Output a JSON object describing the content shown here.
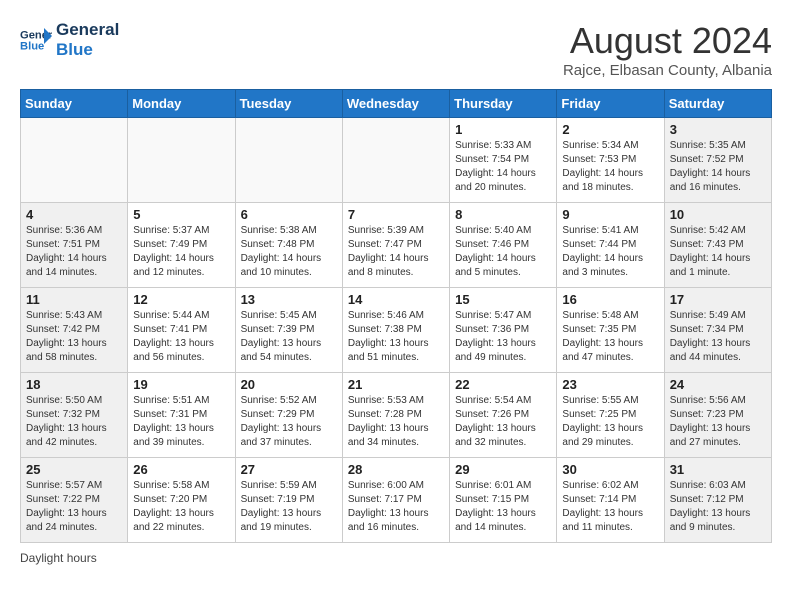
{
  "header": {
    "logo_line1": "General",
    "logo_line2": "Blue",
    "month_title": "August 2024",
    "subtitle": "Rajce, Elbasan County, Albania"
  },
  "calendar": {
    "days_of_week": [
      "Sunday",
      "Monday",
      "Tuesday",
      "Wednesday",
      "Thursday",
      "Friday",
      "Saturday"
    ],
    "weeks": [
      [
        {
          "day": "",
          "info": "",
          "empty": true
        },
        {
          "day": "",
          "info": "",
          "empty": true
        },
        {
          "day": "",
          "info": "",
          "empty": true
        },
        {
          "day": "",
          "info": "",
          "empty": true
        },
        {
          "day": "1",
          "info": "Sunrise: 5:33 AM\nSunset: 7:54 PM\nDaylight: 14 hours\nand 20 minutes.",
          "empty": false
        },
        {
          "day": "2",
          "info": "Sunrise: 5:34 AM\nSunset: 7:53 PM\nDaylight: 14 hours\nand 18 minutes.",
          "empty": false
        },
        {
          "day": "3",
          "info": "Sunrise: 5:35 AM\nSunset: 7:52 PM\nDaylight: 14 hours\nand 16 minutes.",
          "empty": false
        }
      ],
      [
        {
          "day": "4",
          "info": "Sunrise: 5:36 AM\nSunset: 7:51 PM\nDaylight: 14 hours\nand 14 minutes.",
          "empty": false
        },
        {
          "day": "5",
          "info": "Sunrise: 5:37 AM\nSunset: 7:49 PM\nDaylight: 14 hours\nand 12 minutes.",
          "empty": false
        },
        {
          "day": "6",
          "info": "Sunrise: 5:38 AM\nSunset: 7:48 PM\nDaylight: 14 hours\nand 10 minutes.",
          "empty": false
        },
        {
          "day": "7",
          "info": "Sunrise: 5:39 AM\nSunset: 7:47 PM\nDaylight: 14 hours\nand 8 minutes.",
          "empty": false
        },
        {
          "day": "8",
          "info": "Sunrise: 5:40 AM\nSunset: 7:46 PM\nDaylight: 14 hours\nand 5 minutes.",
          "empty": false
        },
        {
          "day": "9",
          "info": "Sunrise: 5:41 AM\nSunset: 7:44 PM\nDaylight: 14 hours\nand 3 minutes.",
          "empty": false
        },
        {
          "day": "10",
          "info": "Sunrise: 5:42 AM\nSunset: 7:43 PM\nDaylight: 14 hours\nand 1 minute.",
          "empty": false
        }
      ],
      [
        {
          "day": "11",
          "info": "Sunrise: 5:43 AM\nSunset: 7:42 PM\nDaylight: 13 hours\nand 58 minutes.",
          "empty": false
        },
        {
          "day": "12",
          "info": "Sunrise: 5:44 AM\nSunset: 7:41 PM\nDaylight: 13 hours\nand 56 minutes.",
          "empty": false
        },
        {
          "day": "13",
          "info": "Sunrise: 5:45 AM\nSunset: 7:39 PM\nDaylight: 13 hours\nand 54 minutes.",
          "empty": false
        },
        {
          "day": "14",
          "info": "Sunrise: 5:46 AM\nSunset: 7:38 PM\nDaylight: 13 hours\nand 51 minutes.",
          "empty": false
        },
        {
          "day": "15",
          "info": "Sunrise: 5:47 AM\nSunset: 7:36 PM\nDaylight: 13 hours\nand 49 minutes.",
          "empty": false
        },
        {
          "day": "16",
          "info": "Sunrise: 5:48 AM\nSunset: 7:35 PM\nDaylight: 13 hours\nand 47 minutes.",
          "empty": false
        },
        {
          "day": "17",
          "info": "Sunrise: 5:49 AM\nSunset: 7:34 PM\nDaylight: 13 hours\nand 44 minutes.",
          "empty": false
        }
      ],
      [
        {
          "day": "18",
          "info": "Sunrise: 5:50 AM\nSunset: 7:32 PM\nDaylight: 13 hours\nand 42 minutes.",
          "empty": false
        },
        {
          "day": "19",
          "info": "Sunrise: 5:51 AM\nSunset: 7:31 PM\nDaylight: 13 hours\nand 39 minutes.",
          "empty": false
        },
        {
          "day": "20",
          "info": "Sunrise: 5:52 AM\nSunset: 7:29 PM\nDaylight: 13 hours\nand 37 minutes.",
          "empty": false
        },
        {
          "day": "21",
          "info": "Sunrise: 5:53 AM\nSunset: 7:28 PM\nDaylight: 13 hours\nand 34 minutes.",
          "empty": false
        },
        {
          "day": "22",
          "info": "Sunrise: 5:54 AM\nSunset: 7:26 PM\nDaylight: 13 hours\nand 32 minutes.",
          "empty": false
        },
        {
          "day": "23",
          "info": "Sunrise: 5:55 AM\nSunset: 7:25 PM\nDaylight: 13 hours\nand 29 minutes.",
          "empty": false
        },
        {
          "day": "24",
          "info": "Sunrise: 5:56 AM\nSunset: 7:23 PM\nDaylight: 13 hours\nand 27 minutes.",
          "empty": false
        }
      ],
      [
        {
          "day": "25",
          "info": "Sunrise: 5:57 AM\nSunset: 7:22 PM\nDaylight: 13 hours\nand 24 minutes.",
          "empty": false
        },
        {
          "day": "26",
          "info": "Sunrise: 5:58 AM\nSunset: 7:20 PM\nDaylight: 13 hours\nand 22 minutes.",
          "empty": false
        },
        {
          "day": "27",
          "info": "Sunrise: 5:59 AM\nSunset: 7:19 PM\nDaylight: 13 hours\nand 19 minutes.",
          "empty": false
        },
        {
          "day": "28",
          "info": "Sunrise: 6:00 AM\nSunset: 7:17 PM\nDaylight: 13 hours\nand 16 minutes.",
          "empty": false
        },
        {
          "day": "29",
          "info": "Sunrise: 6:01 AM\nSunset: 7:15 PM\nDaylight: 13 hours\nand 14 minutes.",
          "empty": false
        },
        {
          "day": "30",
          "info": "Sunrise: 6:02 AM\nSunset: 7:14 PM\nDaylight: 13 hours\nand 11 minutes.",
          "empty": false
        },
        {
          "day": "31",
          "info": "Sunrise: 6:03 AM\nSunset: 7:12 PM\nDaylight: 13 hours\nand 9 minutes.",
          "empty": false
        }
      ]
    ]
  },
  "footer": {
    "daylight_label": "Daylight hours"
  }
}
